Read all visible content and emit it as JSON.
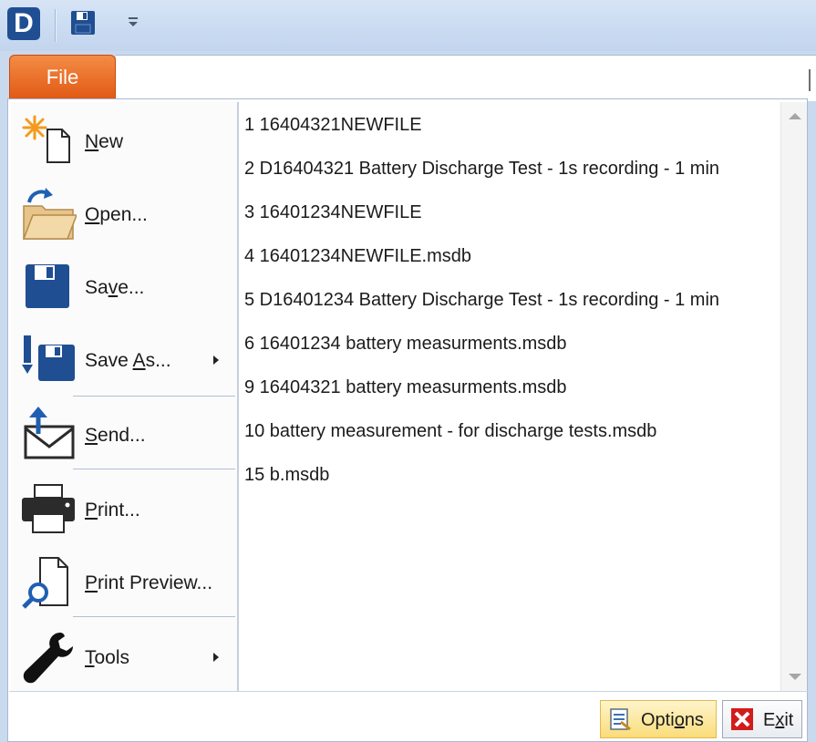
{
  "qat": {
    "app_letter": "D",
    "icons": [
      "app-logo-icon",
      "save-icon",
      "customize-dropdown-icon"
    ]
  },
  "file_tab": {
    "label": "File"
  },
  "menu": {
    "items": [
      {
        "label_pre": "",
        "label_ul": "N",
        "label_post": "ew",
        "icon": "new-file-icon",
        "has_submenu": false
      },
      {
        "label_pre": "",
        "label_ul": "O",
        "label_post": "pen...",
        "icon": "open-folder-icon",
        "has_submenu": false
      },
      {
        "label_pre": "Sa",
        "label_ul": "v",
        "label_post": "e...",
        "icon": "save-icon",
        "has_submenu": false
      },
      {
        "label_pre": "Save ",
        "label_ul": "A",
        "label_post": "s...",
        "icon": "save-as-icon",
        "has_submenu": true
      },
      {
        "label_pre": "",
        "label_ul": "S",
        "label_post": "end...",
        "icon": "send-icon",
        "has_submenu": false
      },
      {
        "label_pre": "",
        "label_ul": "P",
        "label_post": "rint...",
        "icon": "print-icon",
        "has_submenu": false
      },
      {
        "label_pre": "",
        "label_ul": "P",
        "label_post": "rint Preview...",
        "icon": "print-preview-icon",
        "has_submenu": false
      },
      {
        "label_pre": "",
        "label_ul": "T",
        "label_post": "ools",
        "icon": "wrench-icon",
        "has_submenu": true
      }
    ]
  },
  "recent_files": [
    "1 16404321NEWFILE",
    "2 D16404321 Battery Discharge Test - 1s recording - 1 min",
    "3 16401234NEWFILE",
    "4 16401234NEWFILE.msdb",
    "5 D16401234 Battery Discharge Test - 1s recording - 1 min",
    "6 16401234 battery measurments.msdb",
    "9 16404321 battery measurments.msdb",
    "10 battery measurement - for discharge tests.msdb",
    "15 b.msdb"
  ],
  "footer": {
    "options_pre": "Opti",
    "options_ul": "o",
    "options_post": "ns",
    "exit_pre": "E",
    "exit_ul": "x",
    "exit_post": "it"
  },
  "colors": {
    "file_tab": "#e8661f",
    "title_bar": "#c9d9ee",
    "options_highlight": "#f9dc7a",
    "exit_red": "#d21c1c"
  }
}
